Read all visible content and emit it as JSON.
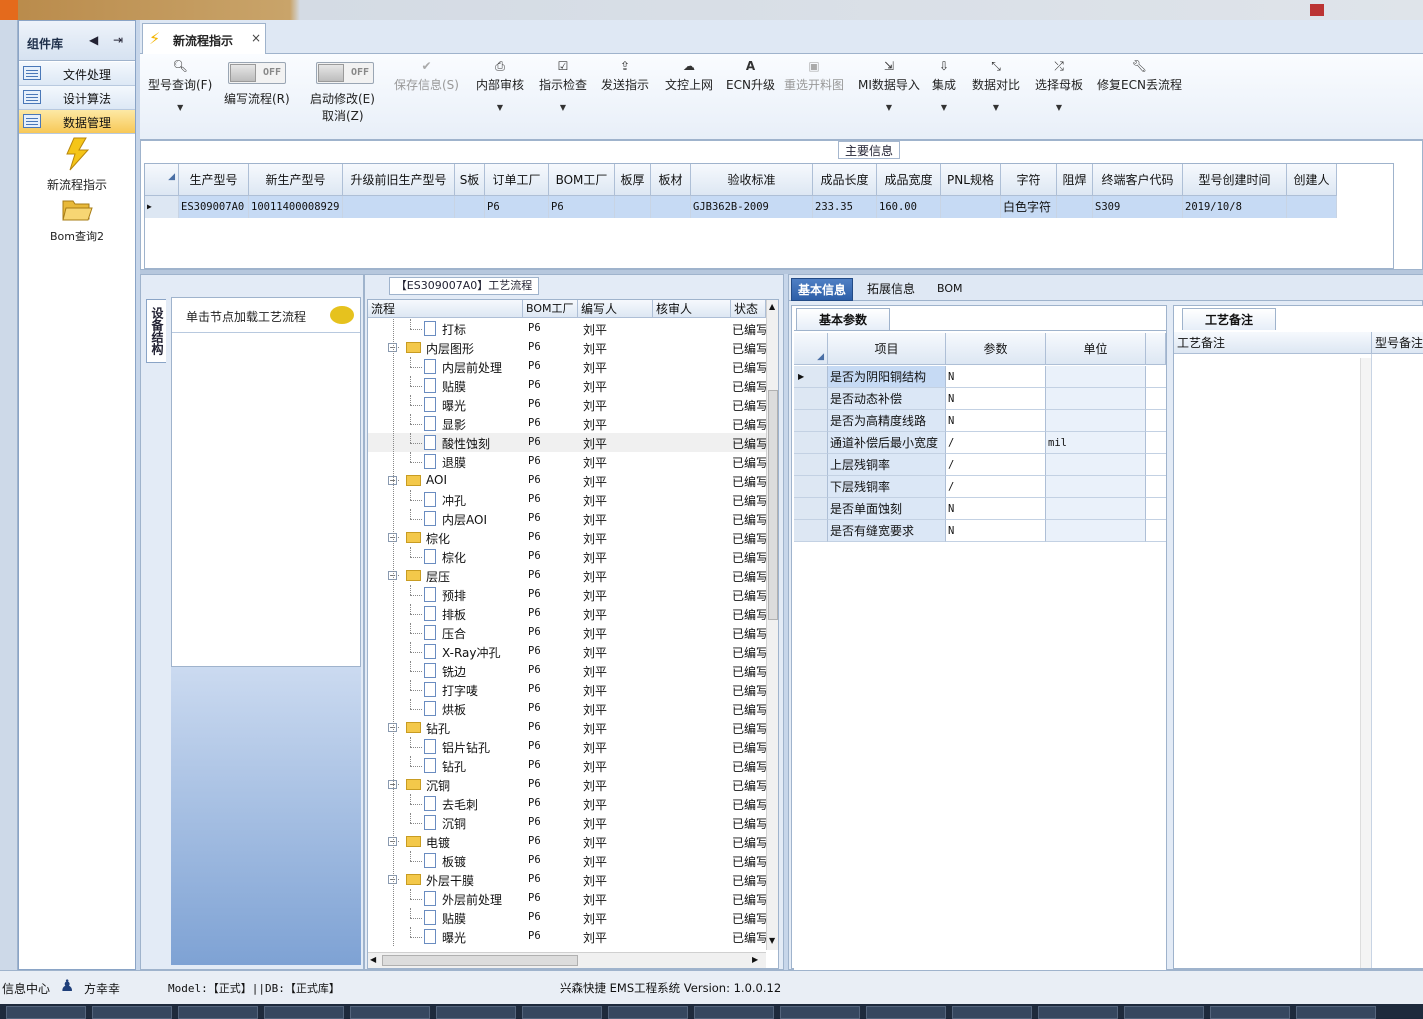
{
  "left_panel": {
    "title": "组件库",
    "items": [
      "文件处理",
      "设计算法",
      "数据管理"
    ],
    "active_index": 2,
    "shortcuts": [
      {
        "label": "新流程指示",
        "icon": "lightning-icon"
      },
      {
        "label": "Bom查询2",
        "icon": "folder-open-icon"
      }
    ]
  },
  "tab": {
    "label": "新流程指示",
    "close": "×"
  },
  "toolbar": {
    "model_query": "型号查询(F)",
    "toggle_off": "OFF",
    "write_flow": "编写流程(R)",
    "start_edit": "启动修改(E)",
    "cancel": "取消(Z)",
    "save_info": "保存信息(S)",
    "internal_review": "内部审核",
    "instruction_check": "指示检查",
    "send_instruction": "发送指示",
    "doc_upload": "文控上网",
    "ecn_upgrade": "ECN升级",
    "reselect_cut": "重选开料图",
    "mi_import": "MI数据导入",
    "integrate": "集成",
    "data_compare": "数据对比",
    "select_master": "选择母板",
    "repair_ecn": "修复ECN丢流程"
  },
  "main_info": {
    "title": "主要信息",
    "columns": [
      "生产型号",
      "新生产型号",
      "升级前旧生产型号",
      "S板",
      "订单工厂",
      "BOM工厂",
      "板厚",
      "板材",
      "验收标准",
      "成品长度",
      "成品宽度",
      "PNL规格",
      "字符",
      "阻焊",
      "终端客户代码",
      "型号创建时间",
      "创建人"
    ],
    "row": [
      "ES309007A0",
      "10011400008929",
      "",
      "",
      "P6",
      "P6",
      "",
      "",
      "GJB362B-2009",
      "233.35",
      "160.00",
      "",
      "白色字符",
      "",
      "S309",
      "2019/10/8",
      ""
    ]
  },
  "left_sub": {
    "vtab": "设备结构",
    "hint": "单击节点加载工艺流程"
  },
  "process": {
    "title": "【ES309007A0】工艺流程",
    "columns": [
      "流程",
      "BOM工厂",
      "编写人",
      "核审人",
      "状态"
    ],
    "rows": [
      {
        "name": "打标",
        "level": 1,
        "folder": false,
        "bom": "P6",
        "writer": "刘平",
        "status": "已编写"
      },
      {
        "name": "内层图形",
        "level": 0,
        "folder": true,
        "bom": "P6",
        "writer": "刘平",
        "status": "已编写"
      },
      {
        "name": "内层前处理",
        "level": 1,
        "folder": false,
        "bom": "P6",
        "writer": "刘平",
        "status": "已编写"
      },
      {
        "name": "贴膜",
        "level": 1,
        "folder": false,
        "bom": "P6",
        "writer": "刘平",
        "status": "已编写"
      },
      {
        "name": "曝光",
        "level": 1,
        "folder": false,
        "bom": "P6",
        "writer": "刘平",
        "status": "已编写"
      },
      {
        "name": "显影",
        "level": 1,
        "folder": false,
        "bom": "P6",
        "writer": "刘平",
        "status": "已编写"
      },
      {
        "name": "酸性蚀刻",
        "level": 1,
        "folder": false,
        "bom": "P6",
        "writer": "刘平",
        "status": "已编写",
        "selected": true
      },
      {
        "name": "退膜",
        "level": 1,
        "folder": false,
        "bom": "P6",
        "writer": "刘平",
        "status": "已编写"
      },
      {
        "name": "AOI",
        "level": 0,
        "folder": true,
        "bom": "P6",
        "writer": "刘平",
        "status": "已编写"
      },
      {
        "name": "冲孔",
        "level": 1,
        "folder": false,
        "bom": "P6",
        "writer": "刘平",
        "status": "已编写"
      },
      {
        "name": "内层AOI",
        "level": 1,
        "folder": false,
        "bom": "P6",
        "writer": "刘平",
        "status": "已编写"
      },
      {
        "name": "棕化",
        "level": 0,
        "folder": true,
        "bom": "P6",
        "writer": "刘平",
        "status": "已编写"
      },
      {
        "name": "棕化",
        "level": 1,
        "folder": false,
        "bom": "P6",
        "writer": "刘平",
        "status": "已编写"
      },
      {
        "name": "层压",
        "level": 0,
        "folder": true,
        "bom": "P6",
        "writer": "刘平",
        "status": "已编写"
      },
      {
        "name": "预排",
        "level": 1,
        "folder": false,
        "bom": "P6",
        "writer": "刘平",
        "status": "已编写"
      },
      {
        "name": "排板",
        "level": 1,
        "folder": false,
        "bom": "P6",
        "writer": "刘平",
        "status": "已编写"
      },
      {
        "name": "压合",
        "level": 1,
        "folder": false,
        "bom": "P6",
        "writer": "刘平",
        "status": "已编写"
      },
      {
        "name": "X-Ray冲孔",
        "level": 1,
        "folder": false,
        "bom": "P6",
        "writer": "刘平",
        "status": "已编写"
      },
      {
        "name": "铣边",
        "level": 1,
        "folder": false,
        "bom": "P6",
        "writer": "刘平",
        "status": "已编写"
      },
      {
        "name": "打字唛",
        "level": 1,
        "folder": false,
        "bom": "P6",
        "writer": "刘平",
        "status": "已编写"
      },
      {
        "name": "烘板",
        "level": 1,
        "folder": false,
        "bom": "P6",
        "writer": "刘平",
        "status": "已编写"
      },
      {
        "name": "钻孔",
        "level": 0,
        "folder": true,
        "bom": "P6",
        "writer": "刘平",
        "status": "已编写"
      },
      {
        "name": "铝片钻孔",
        "level": 1,
        "folder": false,
        "bom": "P6",
        "writer": "刘平",
        "status": "已编写"
      },
      {
        "name": "钻孔",
        "level": 1,
        "folder": false,
        "bom": "P6",
        "writer": "刘平",
        "status": "已编写"
      },
      {
        "name": "沉铜",
        "level": 0,
        "folder": true,
        "bom": "P6",
        "writer": "刘平",
        "status": "已编写"
      },
      {
        "name": "去毛刺",
        "level": 1,
        "folder": false,
        "bom": "P6",
        "writer": "刘平",
        "status": "已编写"
      },
      {
        "name": "沉铜",
        "level": 1,
        "folder": false,
        "bom": "P6",
        "writer": "刘平",
        "status": "已编写"
      },
      {
        "name": "电镀",
        "level": 0,
        "folder": true,
        "bom": "P6",
        "writer": "刘平",
        "status": "已编写"
      },
      {
        "name": "板镀",
        "level": 1,
        "folder": false,
        "bom": "P6",
        "writer": "刘平",
        "status": "已编写"
      },
      {
        "name": "外层干膜",
        "level": 0,
        "folder": true,
        "bom": "P6",
        "writer": "刘平",
        "status": "已编写"
      },
      {
        "name": "外层前处理",
        "level": 1,
        "folder": false,
        "bom": "P6",
        "writer": "刘平",
        "status": "已编写"
      },
      {
        "name": "贴膜",
        "level": 1,
        "folder": false,
        "bom": "P6",
        "writer": "刘平",
        "status": "已编写"
      },
      {
        "name": "曝光",
        "level": 1,
        "folder": false,
        "bom": "P6",
        "writer": "刘平",
        "status": "已编写"
      }
    ]
  },
  "detail": {
    "tabs": [
      "基本信息",
      "拓展信息",
      "BOM"
    ],
    "active_tab": 0,
    "params_title": "基本参数",
    "param_columns": [
      "项目",
      "参数",
      "单位"
    ],
    "params": [
      {
        "item": "是否为阴阳铜结构",
        "value": "N",
        "unit": ""
      },
      {
        "item": "是否动态补偿",
        "value": "N",
        "unit": ""
      },
      {
        "item": "是否为高精度线路",
        "value": "N",
        "unit": ""
      },
      {
        "item": "通道补偿后最小宽度",
        "value": "/",
        "unit": "mil"
      },
      {
        "item": "上层残铜率",
        "value": "/",
        "unit": ""
      },
      {
        "item": "下层残铜率",
        "value": "/",
        "unit": ""
      },
      {
        "item": "是否单面蚀刻",
        "value": "N",
        "unit": ""
      },
      {
        "item": "是否有缝宽要求",
        "value": "N",
        "unit": ""
      }
    ],
    "remark_title": "工艺备注",
    "remark_columns": [
      "工艺备注",
      "型号备注"
    ]
  },
  "status": {
    "info_center": "信息中心",
    "user": "方幸幸",
    "model_db": "Model:【正式】||DB:【正式库】",
    "system": "兴森快捷 EMS工程系统 Version: 1.0.0.12"
  }
}
